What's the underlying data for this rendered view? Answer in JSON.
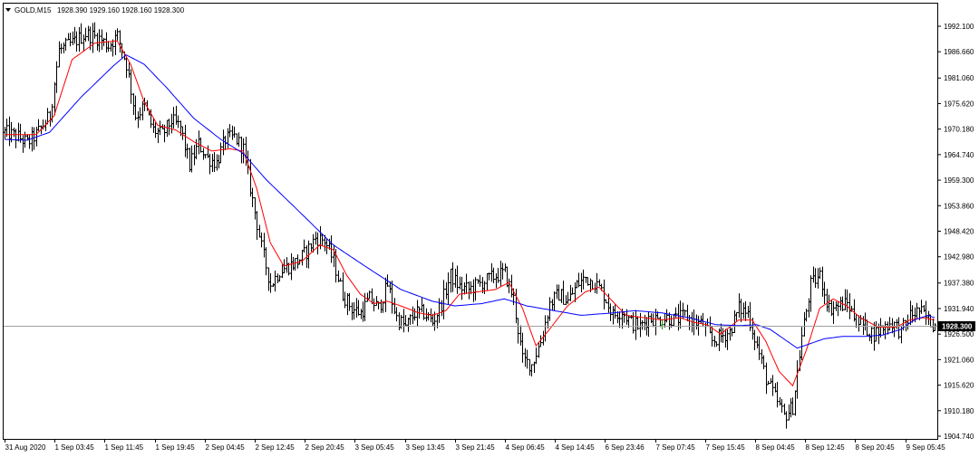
{
  "header": {
    "symbol": "GOLD,M15",
    "ohlc": "1928.390 1929.160 1928.160 1928.300"
  },
  "current_price_label": "1928.300",
  "colors": {
    "background": "#ffffff",
    "bars": "#000000",
    "up_tick": "#00a000",
    "ma_fast": "#ff0000",
    "ma_slow": "#0000ff",
    "price_line": "#a0a0a0",
    "price_label_bg": "#000000"
  },
  "chart_data": {
    "type": "ohlc",
    "title": "GOLD,M15",
    "ylim": [
      1904.74,
      1994.8
    ],
    "y_ticks": [
      "1992.100",
      "1986.660",
      "1981.060",
      "1975.620",
      "1970.180",
      "1964.740",
      "1959.300",
      "1953.860",
      "1948.420",
      "1942.980",
      "1937.380",
      "1931.940",
      "1926.500",
      "1921.060",
      "1915.620",
      "1910.180",
      "1904.740"
    ],
    "x_ticks": [
      "31 Aug 2020",
      "1 Sep 03:45",
      "1 Sep 11:45",
      "1 Sep 19:45",
      "2 Sep 04:45",
      "2 Sep 12:45",
      "2 Sep 20:45",
      "3 Sep 05:45",
      "3 Sep 13:45",
      "3 Sep 21:45",
      "4 Sep 06:45",
      "4 Sep 14:45",
      "6 Sep 23:46",
      "7 Sep 07:45",
      "7 Sep 15:45",
      "8 Sep 04:45",
      "8 Sep 12:45",
      "8 Sep 20:45",
      "9 Sep 05:45"
    ],
    "current_price": 1928.3,
    "price_anchors": [
      [
        0,
        1969.5
      ],
      [
        6,
        1968.5
      ],
      [
        10,
        1967.2
      ],
      [
        14,
        1969.0
      ],
      [
        20,
        1973.0
      ],
      [
        24,
        1987.0
      ],
      [
        30,
        1988.5
      ],
      [
        36,
        1990.5
      ],
      [
        42,
        1989.5
      ],
      [
        46,
        1988.0
      ],
      [
        50,
        1990.0
      ],
      [
        54,
        1984.0
      ],
      [
        58,
        1973.0
      ],
      [
        62,
        1975.0
      ],
      [
        66,
        1970.0
      ],
      [
        70,
        1969.0
      ],
      [
        74,
        1972.0
      ],
      [
        78,
        1970.5
      ],
      [
        82,
        1962.5
      ],
      [
        86,
        1967.0
      ],
      [
        90,
        1964.0
      ],
      [
        94,
        1963.0
      ],
      [
        98,
        1968.0
      ],
      [
        102,
        1968.5
      ],
      [
        106,
        1966.0
      ],
      [
        110,
        1955.0
      ],
      [
        114,
        1945.0
      ],
      [
        118,
        1937.0
      ],
      [
        122,
        1940.0
      ],
      [
        126,
        1941.0
      ],
      [
        130,
        1942.0
      ],
      [
        134,
        1944.0
      ],
      [
        138,
        1947.0
      ],
      [
        142,
        1946.5
      ],
      [
        146,
        1942.0
      ],
      [
        150,
        1935.0
      ],
      [
        154,
        1932.0
      ],
      [
        158,
        1931.0
      ],
      [
        162,
        1934.0
      ],
      [
        166,
        1932.0
      ],
      [
        170,
        1937.0
      ],
      [
        174,
        1930.0
      ],
      [
        178,
        1928.0
      ],
      [
        182,
        1931.0
      ],
      [
        186,
        1931.0
      ],
      [
        190,
        1929.0
      ],
      [
        194,
        1933.0
      ],
      [
        198,
        1939.0
      ],
      [
        202,
        1936.5
      ],
      [
        206,
        1936.0
      ],
      [
        210,
        1937.0
      ],
      [
        214,
        1938.0
      ],
      [
        218,
        1939.0
      ],
      [
        222,
        1939.5
      ],
      [
        226,
        1934.0
      ],
      [
        230,
        1921.0
      ],
      [
        234,
        1920.0
      ],
      [
        238,
        1925.0
      ],
      [
        242,
        1933.0
      ],
      [
        246,
        1935.0
      ],
      [
        250,
        1933.5
      ],
      [
        254,
        1937.0
      ],
      [
        258,
        1938.5
      ],
      [
        262,
        1937.5
      ],
      [
        266,
        1935.0
      ],
      [
        270,
        1930.5
      ],
      [
        274,
        1931.5
      ],
      [
        278,
        1929.0
      ],
      [
        282,
        1928.0
      ],
      [
        286,
        1930.0
      ],
      [
        290,
        1929.5
      ],
      [
        294,
        1930.0
      ],
      [
        298,
        1929.5
      ],
      [
        302,
        1930.5
      ],
      [
        306,
        1929.0
      ],
      [
        310,
        1928.5
      ],
      [
        314,
        1925.0
      ],
      [
        318,
        1926.0
      ],
      [
        322,
        1927.0
      ],
      [
        326,
        1932.0
      ],
      [
        330,
        1931.0
      ],
      [
        334,
        1924.0
      ],
      [
        338,
        1917.0
      ],
      [
        342,
        1913.0
      ],
      [
        346,
        1909.0
      ],
      [
        350,
        1911.0
      ],
      [
        354,
        1926.0
      ],
      [
        358,
        1937.0
      ],
      [
        362,
        1939.0
      ],
      [
        366,
        1932.0
      ],
      [
        370,
        1932.5
      ],
      [
        374,
        1933.0
      ],
      [
        378,
        1929.5
      ],
      [
        382,
        1928.0
      ],
      [
        386,
        1926.5
      ],
      [
        390,
        1928.0
      ],
      [
        394,
        1929.0
      ],
      [
        398,
        1927.0
      ],
      [
        402,
        1930.5
      ],
      [
        406,
        1931.5
      ],
      [
        410,
        1929.5
      ],
      [
        413,
        1928.3
      ]
    ],
    "series": [
      {
        "name": "",
        "color": "#ff0000",
        "values": [
          [
            0,
            1969.0
          ],
          [
            14,
            1969.0
          ],
          [
            22,
            1973.0
          ],
          [
            30,
            1985.0
          ],
          [
            40,
            1988.5
          ],
          [
            50,
            1989.0
          ],
          [
            56,
            1984.0
          ],
          [
            62,
            1976.0
          ],
          [
            68,
            1971.0
          ],
          [
            76,
            1970.0
          ],
          [
            84,
            1967.5
          ],
          [
            92,
            1965.5
          ],
          [
            100,
            1966.0
          ],
          [
            106,
            1965.5
          ],
          [
            112,
            1957.5
          ],
          [
            118,
            1946.0
          ],
          [
            124,
            1941.0
          ],
          [
            132,
            1942.0
          ],
          [
            140,
            1945.5
          ],
          [
            146,
            1944.5
          ],
          [
            152,
            1939.0
          ],
          [
            158,
            1935.0
          ],
          [
            164,
            1933.0
          ],
          [
            170,
            1933.5
          ],
          [
            176,
            1932.5
          ],
          [
            184,
            1931.0
          ],
          [
            190,
            1930.5
          ],
          [
            196,
            1931.5
          ],
          [
            202,
            1935.0
          ],
          [
            210,
            1935.5
          ],
          [
            218,
            1936.0
          ],
          [
            224,
            1937.5
          ],
          [
            230,
            1932.0
          ],
          [
            236,
            1924.0
          ],
          [
            242,
            1927.5
          ],
          [
            250,
            1932.5
          ],
          [
            258,
            1935.5
          ],
          [
            264,
            1936.5
          ],
          [
            270,
            1933.5
          ],
          [
            276,
            1930.5
          ],
          [
            284,
            1930.0
          ],
          [
            292,
            1929.5
          ],
          [
            300,
            1930.0
          ],
          [
            306,
            1929.0
          ],
          [
            312,
            1928.5
          ],
          [
            318,
            1926.5
          ],
          [
            326,
            1929.5
          ],
          [
            332,
            1929.5
          ],
          [
            338,
            1925.0
          ],
          [
            344,
            1918.5
          ],
          [
            350,
            1915.5
          ],
          [
            356,
            1923.0
          ],
          [
            362,
            1932.0
          ],
          [
            368,
            1934.0
          ],
          [
            374,
            1932.5
          ],
          [
            380,
            1930.0
          ],
          [
            388,
            1928.0
          ],
          [
            396,
            1928.0
          ],
          [
            402,
            1929.5
          ],
          [
            408,
            1930.0
          ],
          [
            413,
            1929.5
          ]
        ]
      },
      {
        "name": "",
        "color": "#0000ff",
        "values": [
          [
            0,
            1968.0
          ],
          [
            10,
            1967.8
          ],
          [
            20,
            1969.5
          ],
          [
            34,
            1977.0
          ],
          [
            48,
            1983.5
          ],
          [
            54,
            1986.0
          ],
          [
            62,
            1984.0
          ],
          [
            72,
            1979.0
          ],
          [
            84,
            1972.5
          ],
          [
            96,
            1968.0
          ],
          [
            106,
            1965.0
          ],
          [
            116,
            1959.5
          ],
          [
            130,
            1953.0
          ],
          [
            146,
            1945.5
          ],
          [
            160,
            1941.0
          ],
          [
            176,
            1936.0
          ],
          [
            190,
            1933.5
          ],
          [
            200,
            1932.5
          ],
          [
            212,
            1933.0
          ],
          [
            222,
            1934.0
          ],
          [
            232,
            1932.5
          ],
          [
            244,
            1931.5
          ],
          [
            256,
            1930.5
          ],
          [
            270,
            1931.0
          ],
          [
            280,
            1931.5
          ],
          [
            292,
            1931.0
          ],
          [
            304,
            1930.0
          ],
          [
            316,
            1928.5
          ],
          [
            326,
            1928.3
          ],
          [
            334,
            1928.5
          ],
          [
            340,
            1927.5
          ],
          [
            346,
            1925.5
          ],
          [
            352,
            1923.5
          ],
          [
            358,
            1924.5
          ],
          [
            364,
            1925.5
          ],
          [
            372,
            1926.0
          ],
          [
            382,
            1926.0
          ],
          [
            390,
            1926.3
          ],
          [
            398,
            1927.5
          ],
          [
            404,
            1929.5
          ],
          [
            410,
            1930.5
          ],
          [
            413,
            1930.0
          ]
        ]
      }
    ]
  }
}
